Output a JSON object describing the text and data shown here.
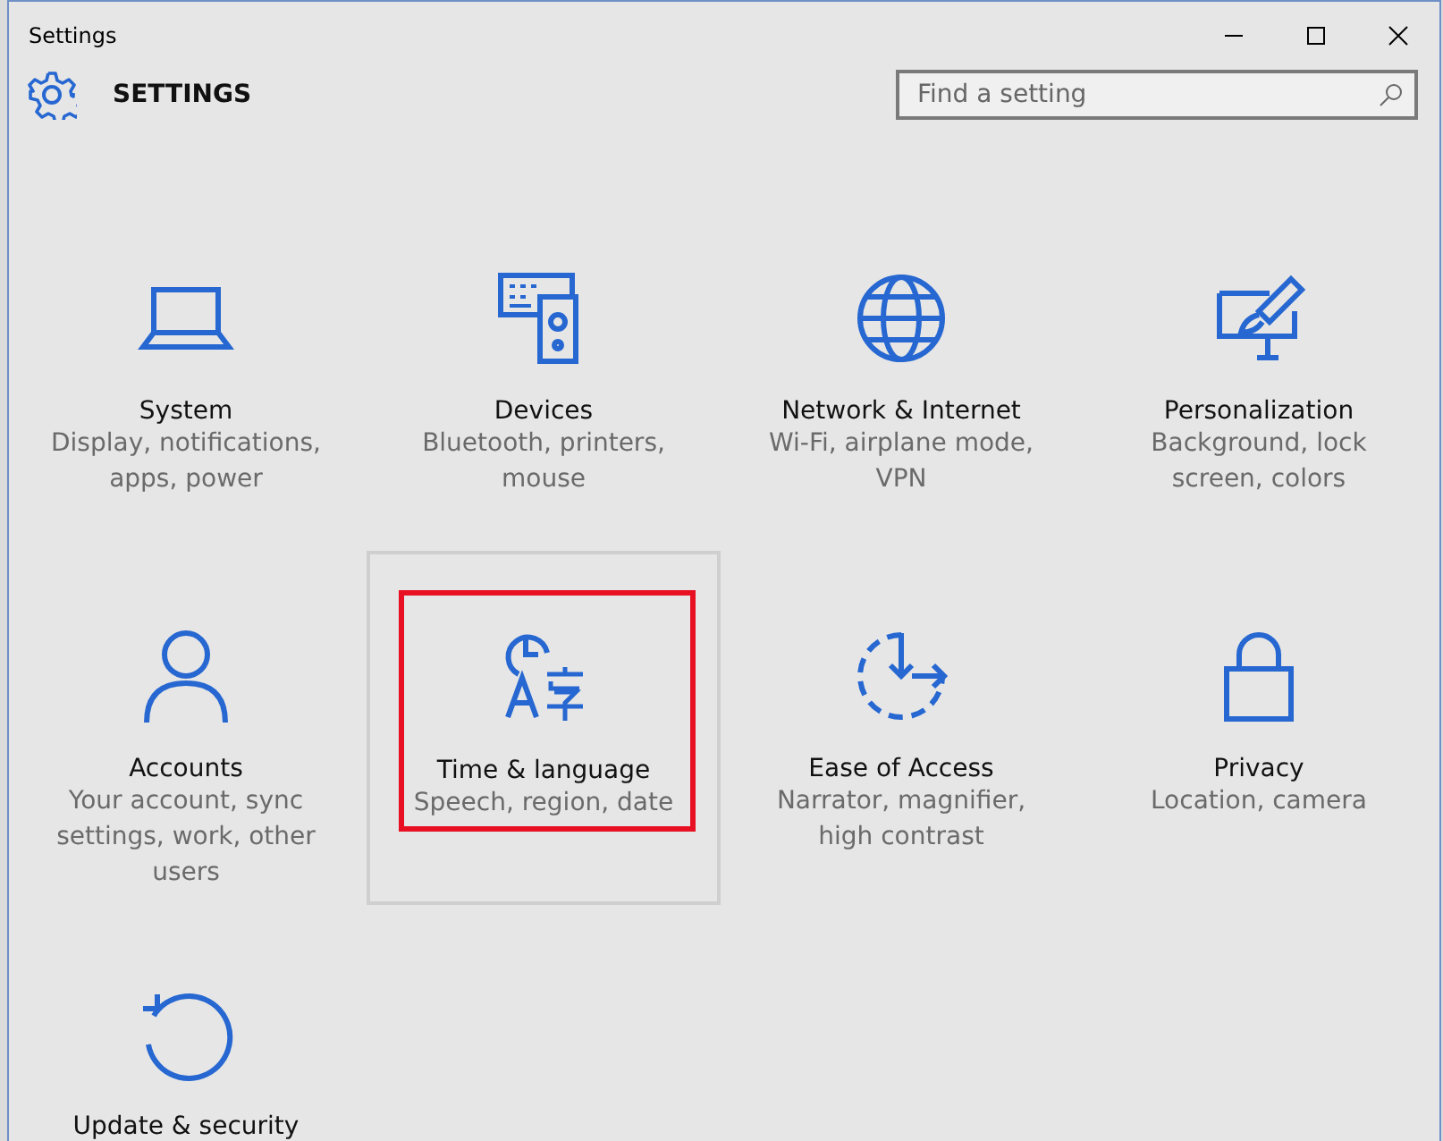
{
  "window": {
    "title": "Settings"
  },
  "header": {
    "title": "SETTINGS",
    "search": {
      "placeholder": "Find a setting"
    }
  },
  "categories": [
    {
      "title": "System",
      "subtitle": "Display, notifications, apps, power",
      "selected": false,
      "highlighted": false
    },
    {
      "title": "Devices",
      "subtitle": "Bluetooth, printers, mouse",
      "selected": false,
      "highlighted": false
    },
    {
      "title": "Network & Internet",
      "subtitle": "Wi-Fi, airplane mode, VPN",
      "selected": false,
      "highlighted": false
    },
    {
      "title": "Personalization",
      "subtitle": "Background, lock screen, colors",
      "selected": false,
      "highlighted": false
    },
    {
      "title": "Accounts",
      "subtitle": "Your account, sync settings, work, other users",
      "selected": false,
      "highlighted": false
    },
    {
      "title": "Time & language",
      "subtitle": "Speech, region, date",
      "selected": true,
      "highlighted": true
    },
    {
      "title": "Ease of Access",
      "subtitle": "Narrator, magnifier, high contrast",
      "selected": false,
      "highlighted": false
    },
    {
      "title": "Privacy",
      "subtitle": "Location, camera",
      "selected": false,
      "highlighted": false
    },
    {
      "title": "Update & security",
      "selected": false,
      "highlighted": false
    }
  ]
}
